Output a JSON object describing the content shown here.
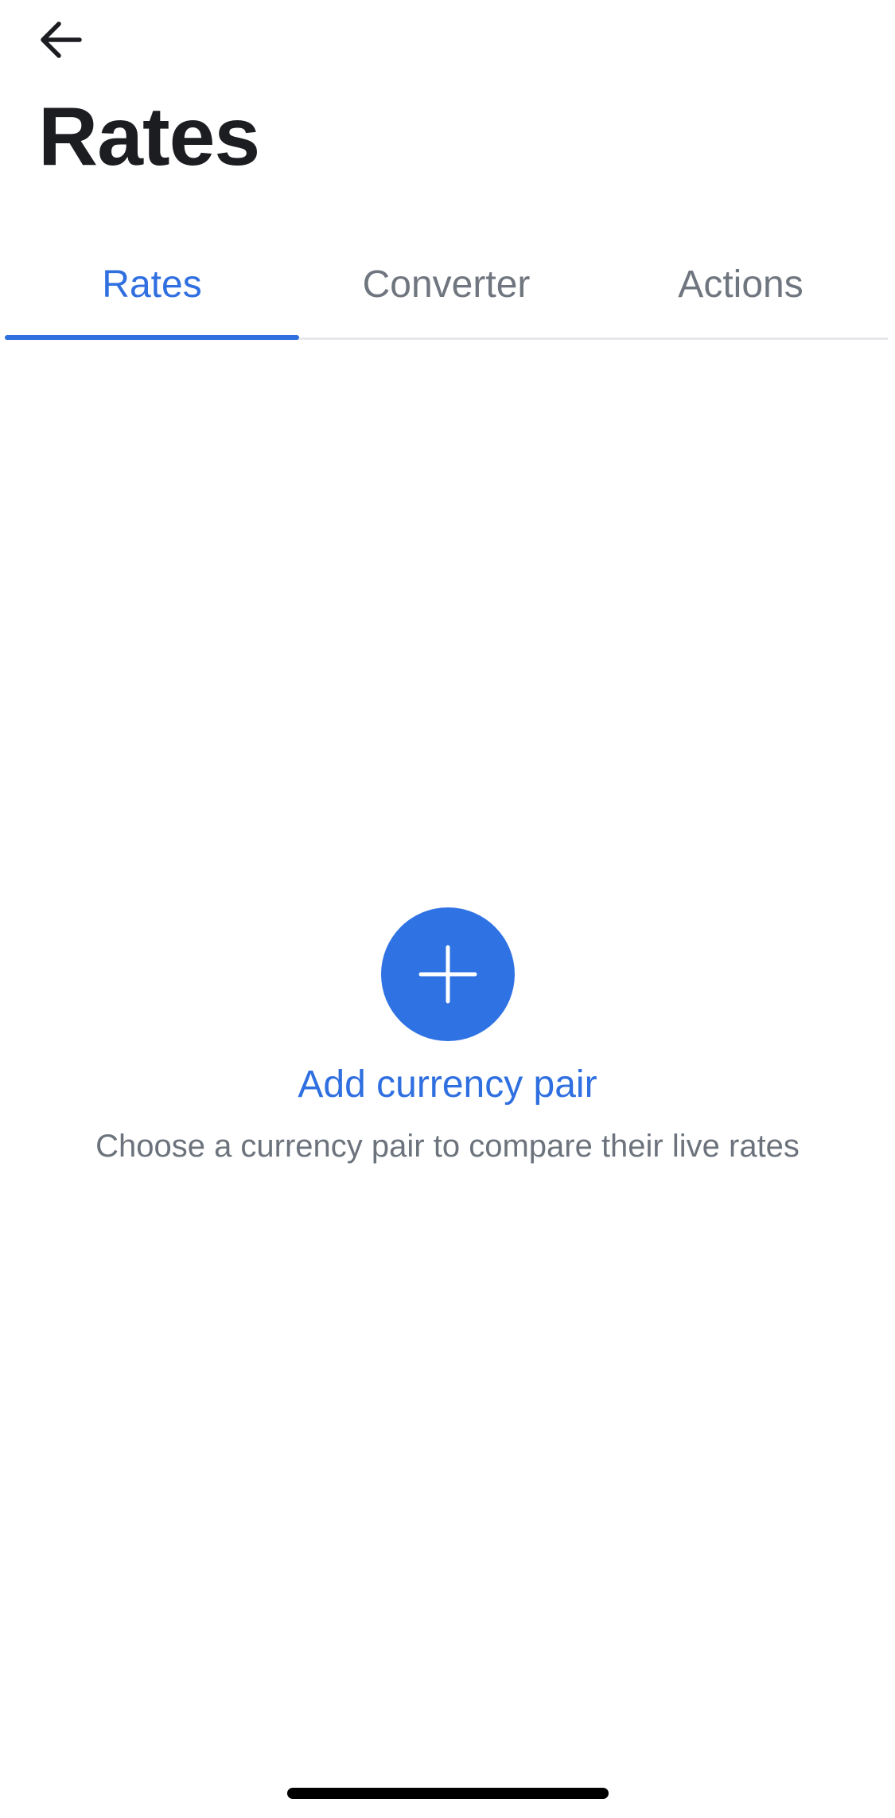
{
  "header": {
    "back_icon": "arrow-left-icon",
    "title": "Rates"
  },
  "tabs": [
    {
      "label": "Rates",
      "active": true
    },
    {
      "label": "Converter",
      "active": false
    },
    {
      "label": "Actions",
      "active": false
    }
  ],
  "empty_state": {
    "icon": "plus-icon",
    "action_label": "Add currency pair",
    "description": "Choose a currency pair to compare their live rates"
  },
  "colors": {
    "accent": "#2f6fe0",
    "title": "#1c1d21",
    "inactive_tab": "#70767f",
    "description": "#6c737c",
    "divider": "#e6e8ec"
  }
}
